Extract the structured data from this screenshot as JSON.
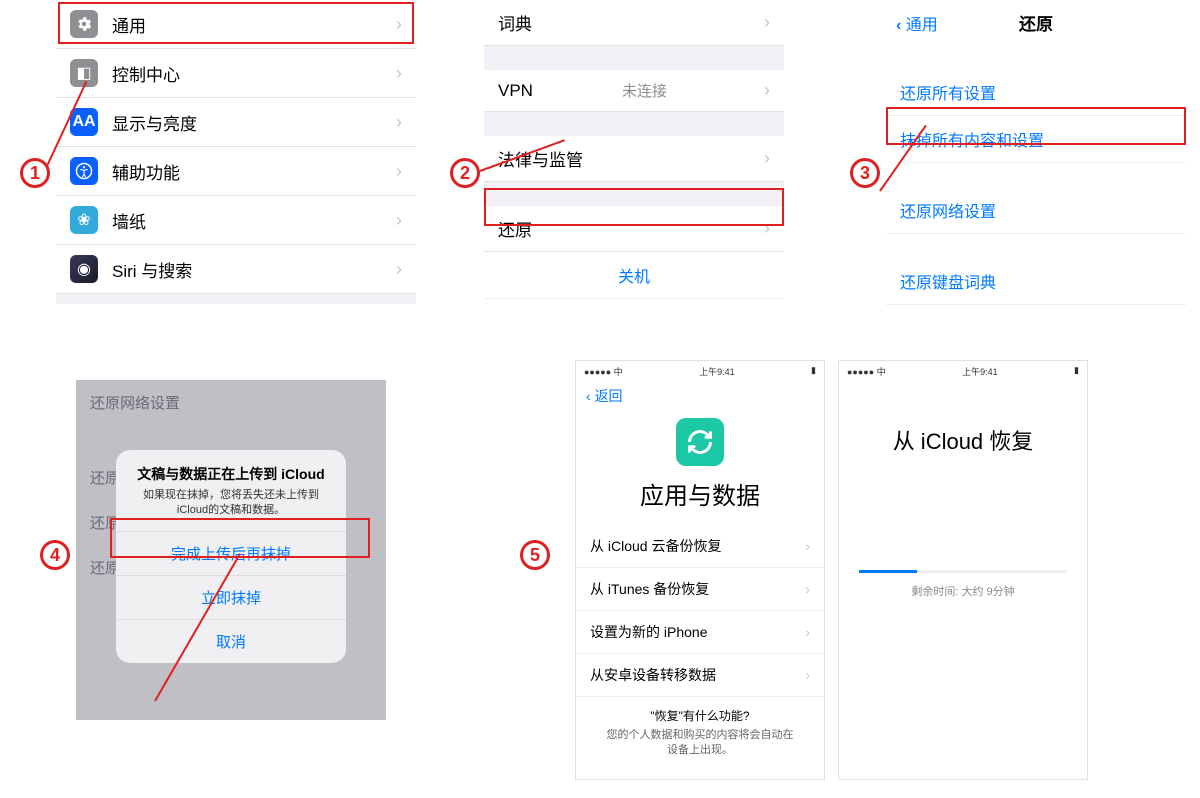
{
  "panel1": {
    "items": [
      {
        "label": "通用",
        "iconColor": "#8e8e93"
      },
      {
        "label": "控制中心",
        "iconColor": "#8e8e93"
      },
      {
        "label": "显示与亮度",
        "iconColor": "#0a60ff"
      },
      {
        "label": "辅助功能",
        "iconColor": "#0a60ff"
      },
      {
        "label": "墙纸",
        "iconColor": "#34aadc"
      },
      {
        "label": "Siri 与搜索",
        "iconColor": "#1c1c1e"
      }
    ]
  },
  "panel2": {
    "dict": "词典",
    "vpn": {
      "label": "VPN",
      "value": "未连接"
    },
    "legal": "法律与监管",
    "reset": "还原",
    "shutdown": "关机"
  },
  "panel3": {
    "back": "通用",
    "title": "还原",
    "reset_all": "还原所有设置",
    "erase_all": "抹掉所有内容和设置",
    "reset_net": "还原网络设置",
    "reset_kbd": "还原键盘词典"
  },
  "panel4": {
    "bg_items": [
      "还原网络设置",
      "还原键",
      "还原主",
      "还原位"
    ],
    "dialog": {
      "title": "文稿与数据正在上传到 iCloud",
      "msg": "如果现在抹掉，您将丢失还未上传到iCloud的文稿和数据。",
      "btn1": "完成上传后再抹掉",
      "btn2": "立即抹掉",
      "btn3": "取消"
    }
  },
  "panel5a": {
    "status_center": "上午9:41",
    "back": "返回",
    "title": "应用与数据",
    "opts": [
      "从 iCloud 云备份恢复",
      "从 iTunes 备份恢复",
      "设置为新的 iPhone",
      "从安卓设备转移数据"
    ],
    "footer_q": "\"恢复\"有什么功能?",
    "footer_d": "您的个人数据和购买的内容将会自动在设备上出现。"
  },
  "panel5b": {
    "status_center": "上午9:41",
    "title": "从 iCloud 恢复",
    "progress_text": "剩余时间: 大约 9分钟"
  },
  "steps": {
    "s1": "1",
    "s2": "2",
    "s3": "3",
    "s4": "4",
    "s5": "5"
  }
}
